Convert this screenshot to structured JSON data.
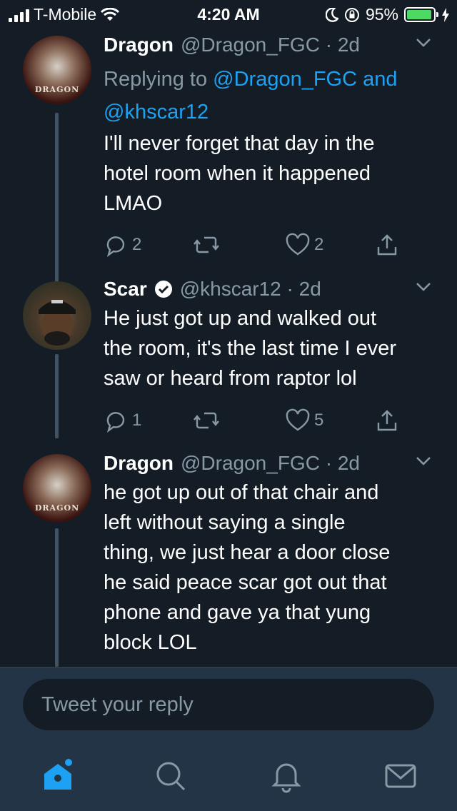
{
  "status_bar": {
    "carrier": "T-Mobile",
    "time": "4:20 AM",
    "battery_percent": "95%",
    "battery_level": 0.95
  },
  "tweets": [
    {
      "name": "Dragon",
      "handle": "@Dragon_FGC",
      "time": "2d",
      "replying_prefix": "Replying to",
      "replying_mention_1": "@Dragon_FGC",
      "replying_and": "and",
      "replying_mention_2": "@khscar12",
      "lines": [
        "I'll never forget that day in the",
        "hotel room when it happened",
        "LMAO"
      ],
      "reply_count": "2",
      "like_count": "2",
      "avatar_text": "DRAGON"
    },
    {
      "name": "Scar",
      "handle": "@khscar12",
      "time": "2d",
      "lines": [
        "He just got up and walked out",
        "the room, it's the last time I ever",
        "saw or heard from raptor lol"
      ],
      "reply_count": "1",
      "like_count": "5"
    },
    {
      "name": "Dragon",
      "handle": "@Dragon_FGC",
      "time": "2d",
      "lines": [
        "he got up out of that chair and",
        "left without saying a single",
        "thing, we just hear a door close",
        "he said peace scar got out that",
        "phone and gave ya that yung",
        "block LOL"
      ],
      "avatar_text": "DRAGON"
    }
  ],
  "reply_box": {
    "placeholder": "Tweet your reply"
  },
  "tab_bar": {
    "icons": [
      "home-icon",
      "search-icon",
      "notifications-icon",
      "messages-icon"
    ],
    "active_color": "#1da1f2"
  },
  "colors": {
    "background": "#141d26",
    "secondary_text": "#8899a6",
    "accent": "#1da1f2",
    "bar_background": "#243447"
  }
}
